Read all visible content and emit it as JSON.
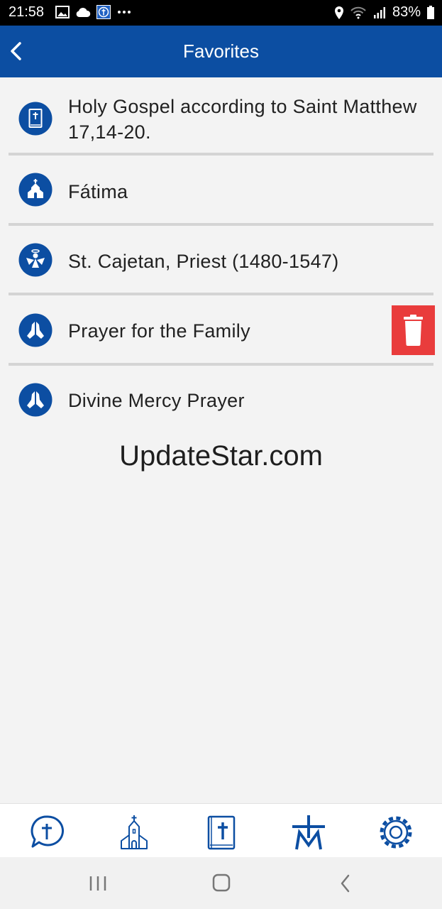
{
  "status_bar": {
    "time": "21:58",
    "battery": "83%",
    "left_icons": [
      "image-icon",
      "cloud-icon",
      "app-notification-icon",
      "more-icon"
    ],
    "right_icons": [
      "location-icon",
      "wifi-icon",
      "signal-icon",
      "battery-icon"
    ]
  },
  "app_bar": {
    "title": "Favorites",
    "back_icon": "chevron-left-icon",
    "color": "#0c4ea2"
  },
  "favorites": {
    "items": [
      {
        "label": "Holy Gospel according to Saint Matthew 17,14-20.",
        "icon": "bible-icon"
      },
      {
        "label": "Fátima",
        "icon": "church-icon"
      },
      {
        "label": "St. Cajetan, Priest (1480-1547)",
        "icon": "angel-icon"
      },
      {
        "label": "Prayer for the Family",
        "icon": "praying-hands-icon"
      },
      {
        "label": "Divine Mercy Prayer",
        "icon": "praying-hands-icon"
      }
    ],
    "delete_icon": "trash-icon",
    "delete_color": "#e93c3c"
  },
  "watermark": "UpdateStar.com",
  "bottom_nav": {
    "items": [
      "chat-cross-icon",
      "church-icon",
      "bible-icon",
      "cross-monogram-icon",
      "settings-gear-icon"
    ]
  },
  "system_nav": {
    "items": [
      "recent-apps-icon",
      "home-icon",
      "back-icon"
    ]
  }
}
